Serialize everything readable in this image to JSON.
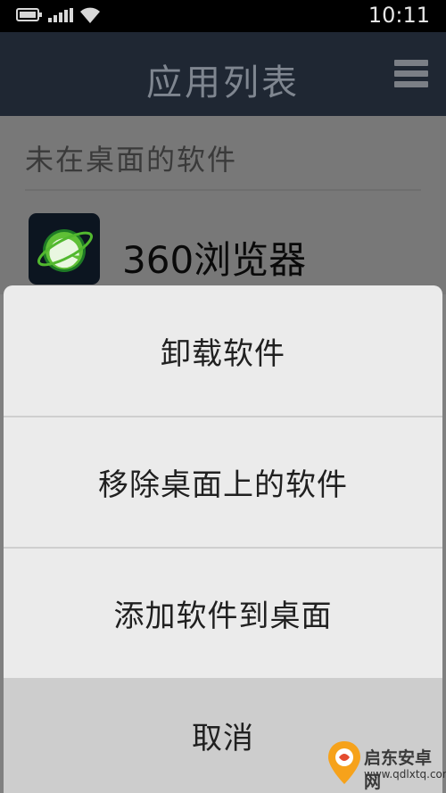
{
  "status_bar": {
    "time": "10:11"
  },
  "header": {
    "title": "应用列表"
  },
  "section": {
    "title": "未在桌面的软件"
  },
  "apps": [
    {
      "name": "360浏览器"
    }
  ],
  "action_sheet": {
    "options": [
      {
        "label": "卸载软件"
      },
      {
        "label": "移除桌面上的软件"
      },
      {
        "label": "添加软件到桌面"
      }
    ],
    "cancel_label": "取消"
  },
  "watermark": {
    "text": "启东安卓网",
    "url": "www.qdlxtq.com"
  },
  "colors": {
    "title_bar": "#1f2733",
    "dim_overlay": "#787878",
    "sheet": "#ebebeb",
    "cancel_bg": "#cdcdcd"
  }
}
